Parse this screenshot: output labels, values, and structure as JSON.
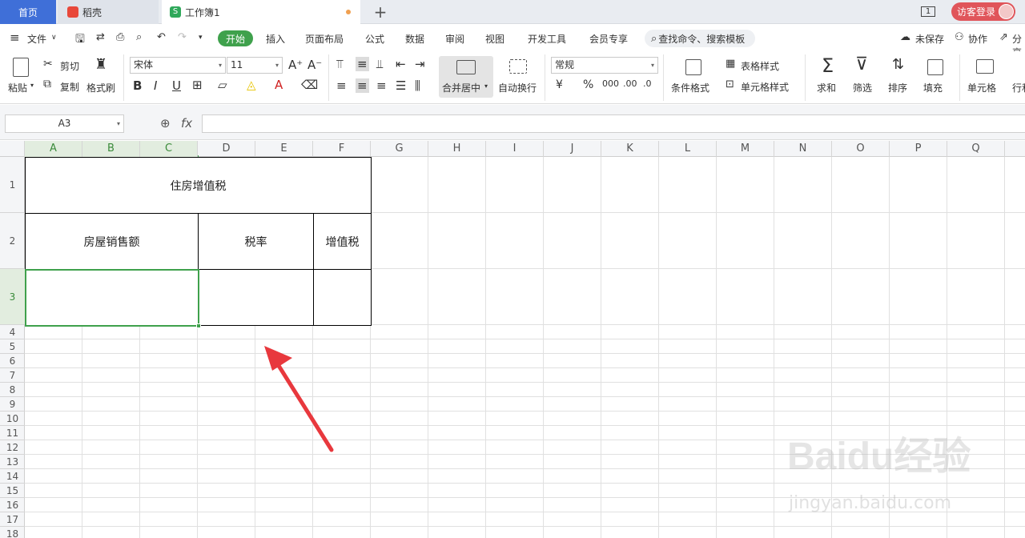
{
  "tabs": {
    "home": "首页",
    "daoke": "稻壳",
    "workbook": "工作簿1",
    "new_tab": "+"
  },
  "titlebar": {
    "window_count": "1",
    "login": "访客登录"
  },
  "menu": {
    "file": "文件",
    "start": "开始",
    "insert": "插入",
    "page_layout": "页面布局",
    "formula": "公式",
    "data": "数据",
    "review": "审阅",
    "view": "视图",
    "dev_tools": "开发工具",
    "member": "会员专享",
    "search": "查找命令、搜索模板",
    "unsaved": "未保存",
    "collab": "协作",
    "share": "分享"
  },
  "ribbon": {
    "paste": "粘贴",
    "cut": "剪切",
    "copy": "复制",
    "format_painter": "格式刷",
    "font_name": "宋体",
    "font_size": "11",
    "merge_center": "合并居中",
    "wrap_text": "自动换行",
    "number_format": "常规",
    "cond_format": "条件格式",
    "table_style": "表格样式",
    "cell_style": "单元格样式",
    "sum": "求和",
    "filter": "筛选",
    "sort": "排序",
    "fill": "填充",
    "cells": "单元格",
    "rows_cols": "行和"
  },
  "formula_bar": {
    "cell_ref": "A3",
    "fx": "fx",
    "value": ""
  },
  "grid": {
    "columns": [
      "A",
      "B",
      "C",
      "D",
      "E",
      "F",
      "G",
      "H",
      "I",
      "J",
      "K",
      "L",
      "M",
      "N",
      "O",
      "P",
      "Q"
    ],
    "rows": [
      "1",
      "2",
      "3",
      "4",
      "5",
      "6",
      "7",
      "8",
      "9",
      "10",
      "11",
      "12",
      "13",
      "14",
      "15",
      "16",
      "17",
      "18"
    ]
  },
  "cells": {
    "title": "住房增值税",
    "header_sales": "房屋销售额",
    "header_rate": "税率",
    "header_vat": "增值税"
  },
  "colors": {
    "accent_green": "#3fa14c",
    "annotation_red": "#e8383d"
  },
  "watermark": {
    "brand": "Baidu经验",
    "url": "jingyan.baidu.com"
  }
}
